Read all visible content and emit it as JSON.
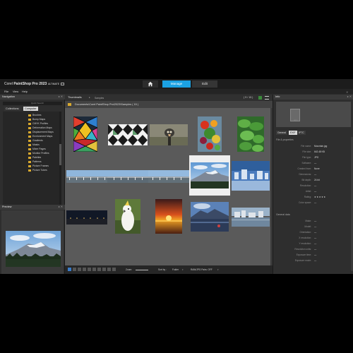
{
  "app": {
    "brand": "Corel",
    "product": "PaintShop Pro",
    "version": "2023",
    "edition": "ULTIMATE"
  },
  "workspace_tabs": {
    "home_icon": "home-icon",
    "manage": "Manage",
    "edit": "Edit"
  },
  "menu": [
    "File",
    "View",
    "Help"
  ],
  "navigation": {
    "title": "Navigation",
    "search_placeholder": "Quick Search",
    "tabs": [
      "Collections",
      "Computer"
    ],
    "folders": [
      "Brushes",
      "Bump Maps",
      "CMYK Profiles",
      "Deformation Maps",
      "Displacement Maps",
      "Environment Maps",
      "Gradients",
      "Masks",
      "Mixer Pages",
      "Monitor Profiles",
      "Palettes",
      "Patterns",
      "Picture Frames",
      "Picture Tubes"
    ]
  },
  "preview": {
    "title": "Preview"
  },
  "browser": {
    "tab_label": "Thumbnails",
    "subfolder": "Samples",
    "count": "( 9 / 15 )",
    "path": "Documents\\Corel PaintShop Pro\\2023\\Samples ( 15 )",
    "thumbnails": [
      {
        "name": "stained-glass",
        "selected": false
      },
      {
        "name": "harlequin-tiles",
        "selected": false
      },
      {
        "name": "ostrich",
        "selected": false
      },
      {
        "name": "vegetables",
        "selected": false
      },
      {
        "name": "green-leaves",
        "selected": false
      },
      {
        "name": "panorama-1",
        "selected": false
      },
      {
        "name": "panorama-2",
        "selected": false
      },
      {
        "name": "panorama-3",
        "selected": false
      },
      {
        "name": "mountain",
        "selected": true
      },
      {
        "name": "snowy-town",
        "selected": false
      },
      {
        "name": "night-panorama",
        "selected": false
      },
      {
        "name": "cockatoo",
        "selected": false
      },
      {
        "name": "sunset",
        "selected": false
      },
      {
        "name": "mountain-lake",
        "selected": false
      },
      {
        "name": "harbor",
        "selected": false
      }
    ]
  },
  "bottom_bar": {
    "zoom_label": "Zoom:",
    "sort_label": "Sort by :",
    "sort_value": "Folder",
    "raw_label": "RAW/JPG Pairs: OFF"
  },
  "info": {
    "title": "Info",
    "preview_format": "JPG",
    "tabs": [
      "General",
      "EXIF",
      "IPTC"
    ],
    "active_tab": "EXIF",
    "section_file": "File & properties",
    "fields": [
      {
        "label": "File name:",
        "value": "Mountain.jpg"
      },
      {
        "label": "File size:",
        "value": "642.48 KB"
      },
      {
        "label": "File type:",
        "value": "JPG"
      },
      {
        "label": "Software:",
        "value": "—"
      },
      {
        "label": "Created from:",
        "value": "None"
      },
      {
        "label": "Dimensions:",
        "value": "—"
      },
      {
        "label": "Bit depth:",
        "value": "24 bit"
      },
      {
        "label": "Resolution:",
        "value": "—"
      },
      {
        "label": "Artist:",
        "value": "—"
      },
      {
        "label": "Rating:",
        "value": "★★★★★"
      },
      {
        "label": "Color space:",
        "value": "—"
      }
    ],
    "section_general": "General data",
    "general_fields": [
      {
        "label": "Make:",
        "value": "—"
      },
      {
        "label": "Model:",
        "value": "—"
      },
      {
        "label": "Orientation:",
        "value": "—"
      },
      {
        "label": "X resolution:",
        "value": "—"
      },
      {
        "label": "Y resolution:",
        "value": "—"
      },
      {
        "label": "Resolution units:",
        "value": "—"
      },
      {
        "label": "Exposure time:",
        "value": "—"
      },
      {
        "label": "Exposure mode:",
        "value": "—"
      }
    ]
  },
  "colors": {
    "accent": "#1ba1e2",
    "folder": "#d9a92e",
    "panel_bg": "#2e2e2e",
    "browser_bg": "#5a5a5a"
  }
}
